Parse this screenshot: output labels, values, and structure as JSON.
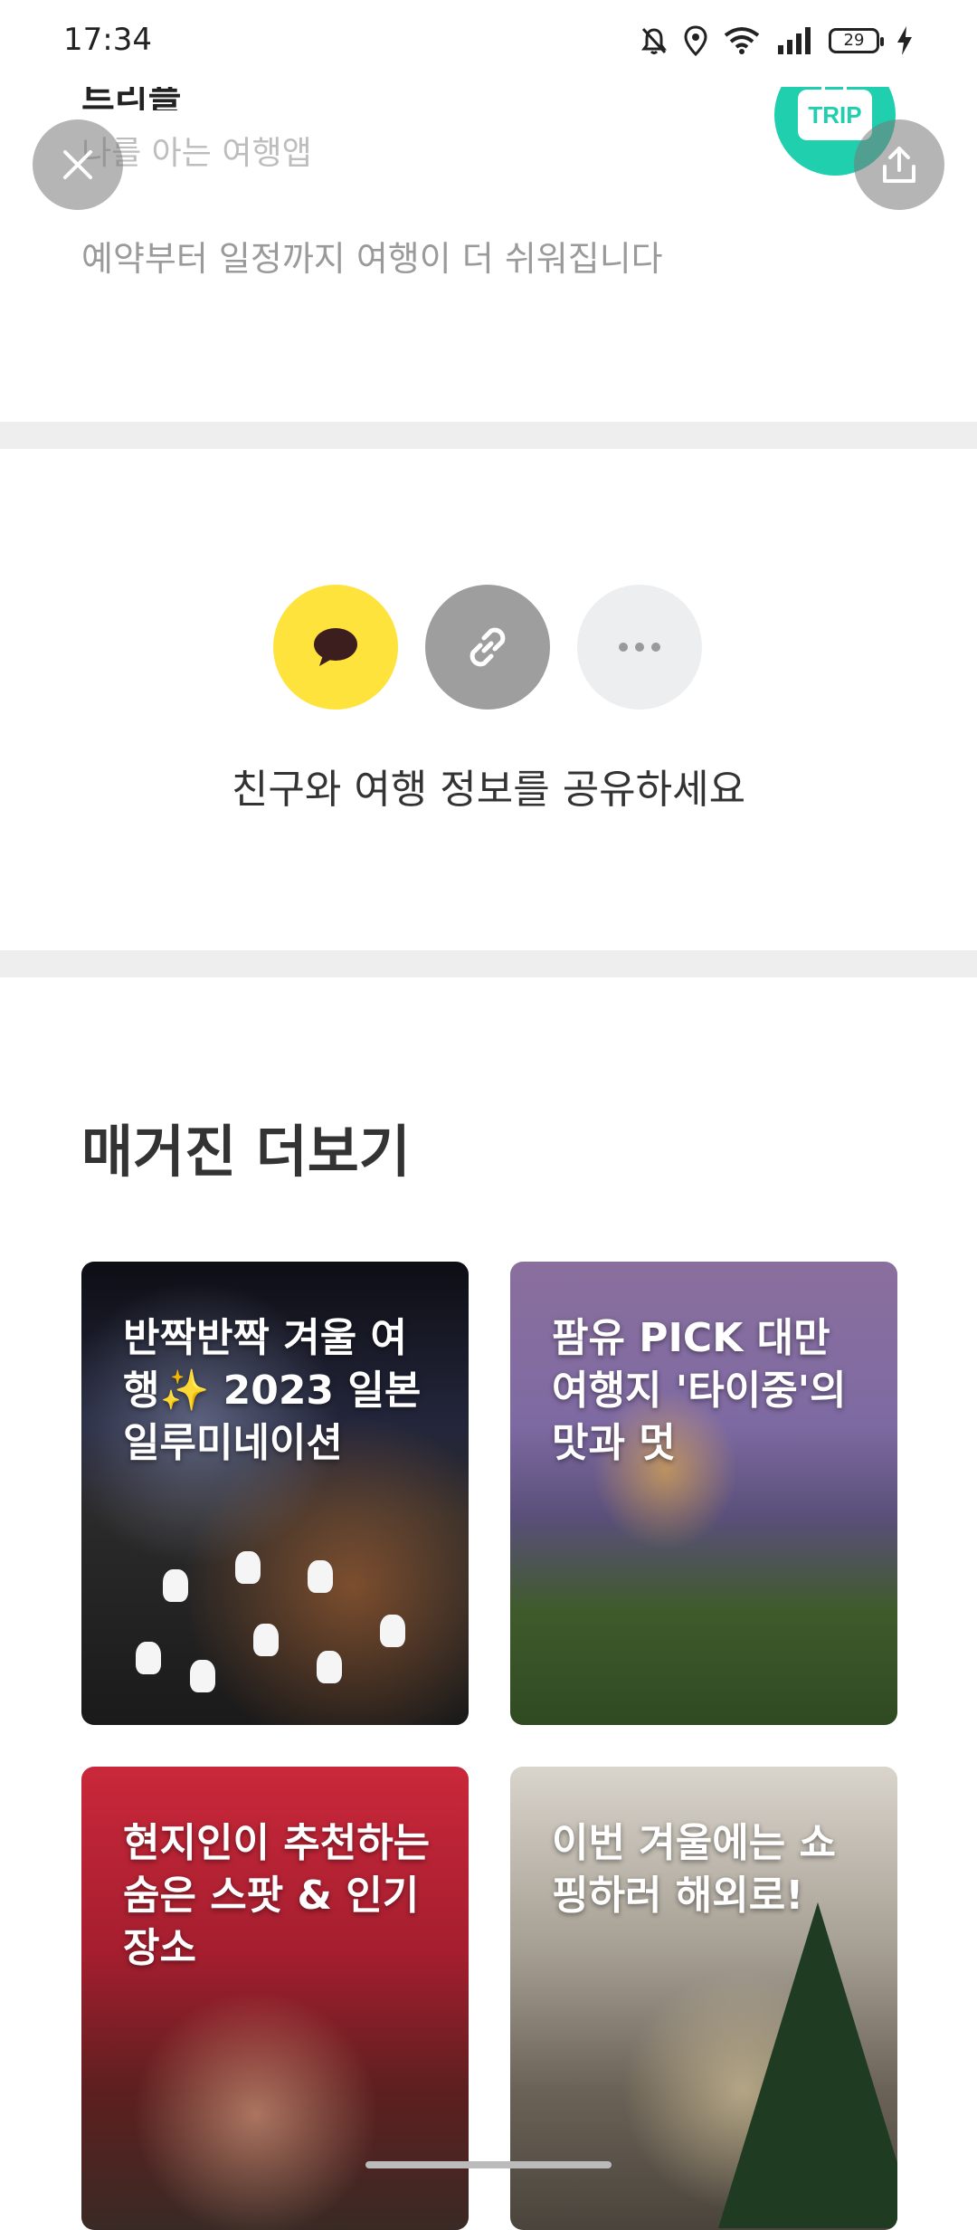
{
  "status_bar": {
    "time": "17:34",
    "battery": "29"
  },
  "header": {
    "partial_title": "트리플",
    "subtitle": "나를 아는 여행앱",
    "tagline": "예약부터 일정까지 여행이 더 쉬워집니다",
    "badge_text": "TRIP"
  },
  "share": {
    "text": "친구와 여행 정보를 공유하세요"
  },
  "magazine": {
    "title": "매거진 더보기",
    "cards": [
      {
        "title": "반짝반짝 겨울 여행✨ 2023 일본 일루미네이션"
      },
      {
        "title": "팜유 PICK 대만 여행지 '타이중'의 맛과 멋"
      },
      {
        "title": "현지인이 추천하는 숨은 스팟 & 인기 장소"
      },
      {
        "title": "이번 겨울에는 쇼핑하러 해외로!"
      }
    ]
  },
  "colors": {
    "kakao": "#fee33c",
    "trip": "#1fcfae",
    "link": "#9e9e9e",
    "more": "#eceeef"
  }
}
